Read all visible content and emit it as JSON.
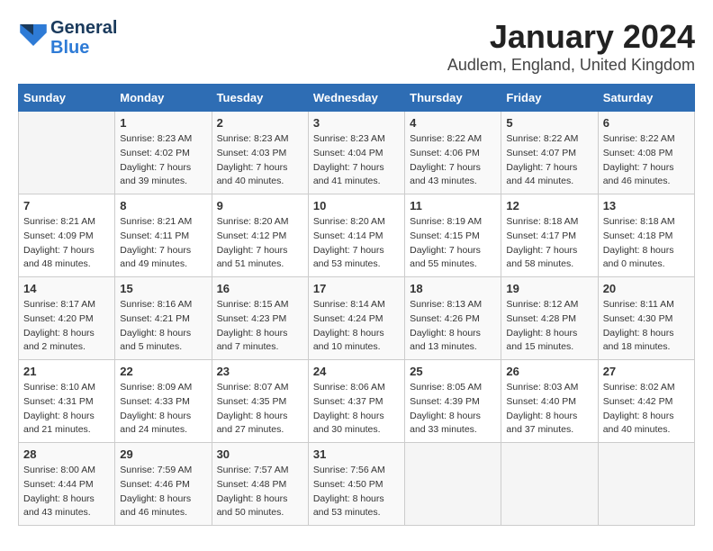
{
  "logo": {
    "general": "General",
    "blue": "Blue"
  },
  "title": "January 2024",
  "location": "Audlem, England, United Kingdom",
  "days_of_week": [
    "Sunday",
    "Monday",
    "Tuesday",
    "Wednesday",
    "Thursday",
    "Friday",
    "Saturday"
  ],
  "weeks": [
    [
      {
        "num": "",
        "sunrise": "",
        "sunset": "",
        "daylight": ""
      },
      {
        "num": "1",
        "sunrise": "Sunrise: 8:23 AM",
        "sunset": "Sunset: 4:02 PM",
        "daylight": "Daylight: 7 hours and 39 minutes."
      },
      {
        "num": "2",
        "sunrise": "Sunrise: 8:23 AM",
        "sunset": "Sunset: 4:03 PM",
        "daylight": "Daylight: 7 hours and 40 minutes."
      },
      {
        "num": "3",
        "sunrise": "Sunrise: 8:23 AM",
        "sunset": "Sunset: 4:04 PM",
        "daylight": "Daylight: 7 hours and 41 minutes."
      },
      {
        "num": "4",
        "sunrise": "Sunrise: 8:22 AM",
        "sunset": "Sunset: 4:06 PM",
        "daylight": "Daylight: 7 hours and 43 minutes."
      },
      {
        "num": "5",
        "sunrise": "Sunrise: 8:22 AM",
        "sunset": "Sunset: 4:07 PM",
        "daylight": "Daylight: 7 hours and 44 minutes."
      },
      {
        "num": "6",
        "sunrise": "Sunrise: 8:22 AM",
        "sunset": "Sunset: 4:08 PM",
        "daylight": "Daylight: 7 hours and 46 minutes."
      }
    ],
    [
      {
        "num": "7",
        "sunrise": "Sunrise: 8:21 AM",
        "sunset": "Sunset: 4:09 PM",
        "daylight": "Daylight: 7 hours and 48 minutes."
      },
      {
        "num": "8",
        "sunrise": "Sunrise: 8:21 AM",
        "sunset": "Sunset: 4:11 PM",
        "daylight": "Daylight: 7 hours and 49 minutes."
      },
      {
        "num": "9",
        "sunrise": "Sunrise: 8:20 AM",
        "sunset": "Sunset: 4:12 PM",
        "daylight": "Daylight: 7 hours and 51 minutes."
      },
      {
        "num": "10",
        "sunrise": "Sunrise: 8:20 AM",
        "sunset": "Sunset: 4:14 PM",
        "daylight": "Daylight: 7 hours and 53 minutes."
      },
      {
        "num": "11",
        "sunrise": "Sunrise: 8:19 AM",
        "sunset": "Sunset: 4:15 PM",
        "daylight": "Daylight: 7 hours and 55 minutes."
      },
      {
        "num": "12",
        "sunrise": "Sunrise: 8:18 AM",
        "sunset": "Sunset: 4:17 PM",
        "daylight": "Daylight: 7 hours and 58 minutes."
      },
      {
        "num": "13",
        "sunrise": "Sunrise: 8:18 AM",
        "sunset": "Sunset: 4:18 PM",
        "daylight": "Daylight: 8 hours and 0 minutes."
      }
    ],
    [
      {
        "num": "14",
        "sunrise": "Sunrise: 8:17 AM",
        "sunset": "Sunset: 4:20 PM",
        "daylight": "Daylight: 8 hours and 2 minutes."
      },
      {
        "num": "15",
        "sunrise": "Sunrise: 8:16 AM",
        "sunset": "Sunset: 4:21 PM",
        "daylight": "Daylight: 8 hours and 5 minutes."
      },
      {
        "num": "16",
        "sunrise": "Sunrise: 8:15 AM",
        "sunset": "Sunset: 4:23 PM",
        "daylight": "Daylight: 8 hours and 7 minutes."
      },
      {
        "num": "17",
        "sunrise": "Sunrise: 8:14 AM",
        "sunset": "Sunset: 4:24 PM",
        "daylight": "Daylight: 8 hours and 10 minutes."
      },
      {
        "num": "18",
        "sunrise": "Sunrise: 8:13 AM",
        "sunset": "Sunset: 4:26 PM",
        "daylight": "Daylight: 8 hours and 13 minutes."
      },
      {
        "num": "19",
        "sunrise": "Sunrise: 8:12 AM",
        "sunset": "Sunset: 4:28 PM",
        "daylight": "Daylight: 8 hours and 15 minutes."
      },
      {
        "num": "20",
        "sunrise": "Sunrise: 8:11 AM",
        "sunset": "Sunset: 4:30 PM",
        "daylight": "Daylight: 8 hours and 18 minutes."
      }
    ],
    [
      {
        "num": "21",
        "sunrise": "Sunrise: 8:10 AM",
        "sunset": "Sunset: 4:31 PM",
        "daylight": "Daylight: 8 hours and 21 minutes."
      },
      {
        "num": "22",
        "sunrise": "Sunrise: 8:09 AM",
        "sunset": "Sunset: 4:33 PM",
        "daylight": "Daylight: 8 hours and 24 minutes."
      },
      {
        "num": "23",
        "sunrise": "Sunrise: 8:07 AM",
        "sunset": "Sunset: 4:35 PM",
        "daylight": "Daylight: 8 hours and 27 minutes."
      },
      {
        "num": "24",
        "sunrise": "Sunrise: 8:06 AM",
        "sunset": "Sunset: 4:37 PM",
        "daylight": "Daylight: 8 hours and 30 minutes."
      },
      {
        "num": "25",
        "sunrise": "Sunrise: 8:05 AM",
        "sunset": "Sunset: 4:39 PM",
        "daylight": "Daylight: 8 hours and 33 minutes."
      },
      {
        "num": "26",
        "sunrise": "Sunrise: 8:03 AM",
        "sunset": "Sunset: 4:40 PM",
        "daylight": "Daylight: 8 hours and 37 minutes."
      },
      {
        "num": "27",
        "sunrise": "Sunrise: 8:02 AM",
        "sunset": "Sunset: 4:42 PM",
        "daylight": "Daylight: 8 hours and 40 minutes."
      }
    ],
    [
      {
        "num": "28",
        "sunrise": "Sunrise: 8:00 AM",
        "sunset": "Sunset: 4:44 PM",
        "daylight": "Daylight: 8 hours and 43 minutes."
      },
      {
        "num": "29",
        "sunrise": "Sunrise: 7:59 AM",
        "sunset": "Sunset: 4:46 PM",
        "daylight": "Daylight: 8 hours and 46 minutes."
      },
      {
        "num": "30",
        "sunrise": "Sunrise: 7:57 AM",
        "sunset": "Sunset: 4:48 PM",
        "daylight": "Daylight: 8 hours and 50 minutes."
      },
      {
        "num": "31",
        "sunrise": "Sunrise: 7:56 AM",
        "sunset": "Sunset: 4:50 PM",
        "daylight": "Daylight: 8 hours and 53 minutes."
      },
      {
        "num": "",
        "sunrise": "",
        "sunset": "",
        "daylight": ""
      },
      {
        "num": "",
        "sunrise": "",
        "sunset": "",
        "daylight": ""
      },
      {
        "num": "",
        "sunrise": "",
        "sunset": "",
        "daylight": ""
      }
    ]
  ]
}
